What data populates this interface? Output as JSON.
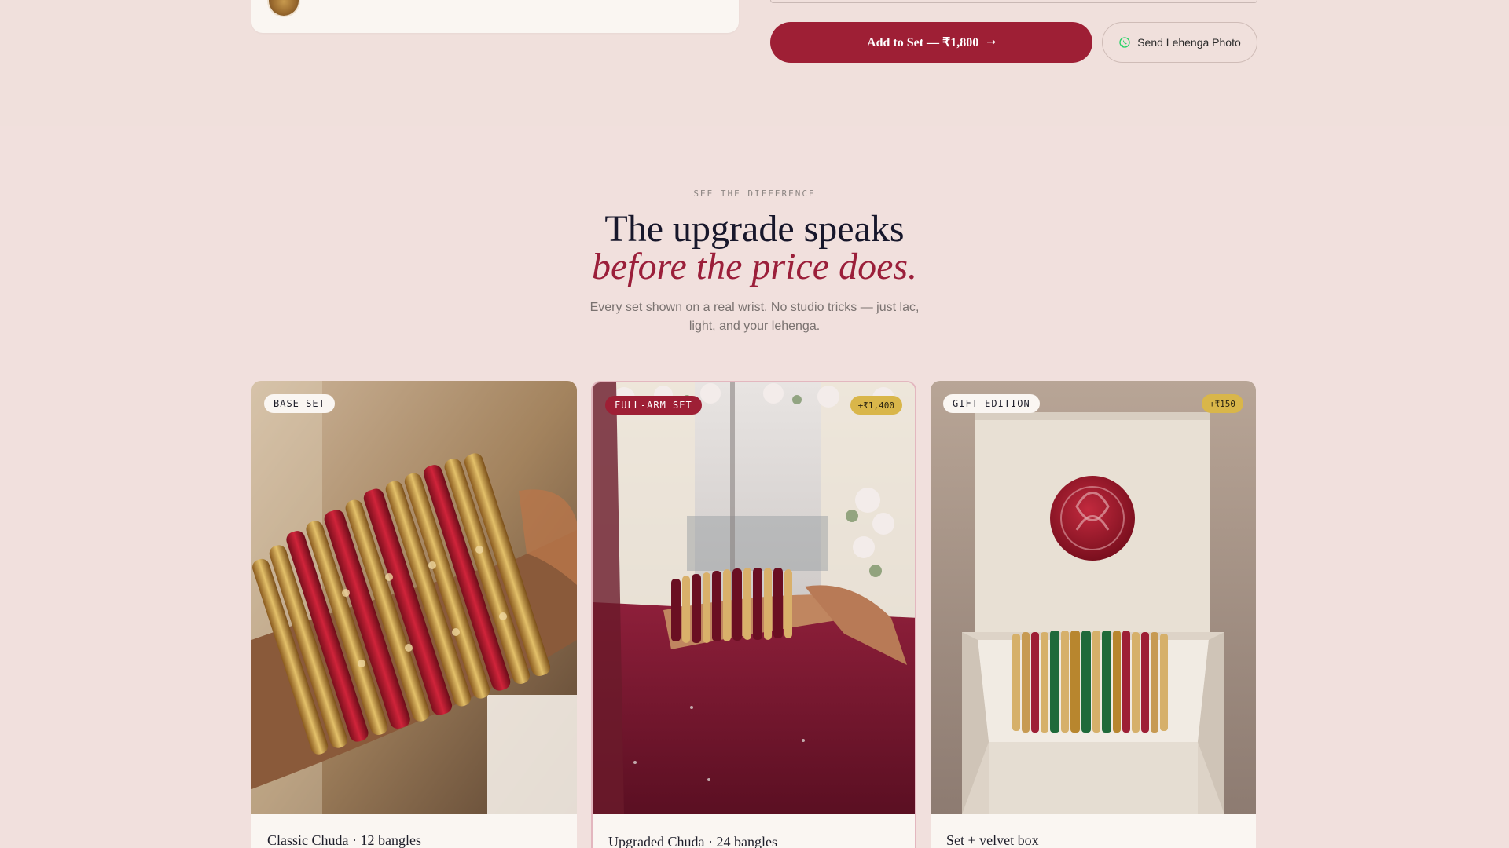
{
  "top": {
    "add_button_label": "Add to Set — ₹1,800",
    "whatsapp_button_label": "Send Lehenga Photo"
  },
  "compare": {
    "eyebrow": "SEE THE DIFFERENCE",
    "title_line1": "The upgrade speaks",
    "title_line2": "before the price does.",
    "subtitle": "Every set shown on a real wrist. No studio tricks — just lac, light, and your lehenga.",
    "cards": [
      {
        "badge": "BASE SET",
        "price": "",
        "caption": "Classic Chuda · 12 bangles"
      },
      {
        "badge": "FULL-ARM SET",
        "price": "+₹1,400",
        "caption": "Upgraded Chuda · 24 bangles"
      },
      {
        "badge": "GIFT EDITION",
        "price": "+₹150",
        "caption": "Set + velvet box"
      }
    ]
  },
  "colors": {
    "accent": "#9e1f35",
    "background": "#f2e1de",
    "gold": "#d9b64a",
    "whatsapp": "#25d366"
  },
  "icons": {
    "arrow": "arrow-right-icon",
    "whatsapp": "whatsapp-icon"
  }
}
